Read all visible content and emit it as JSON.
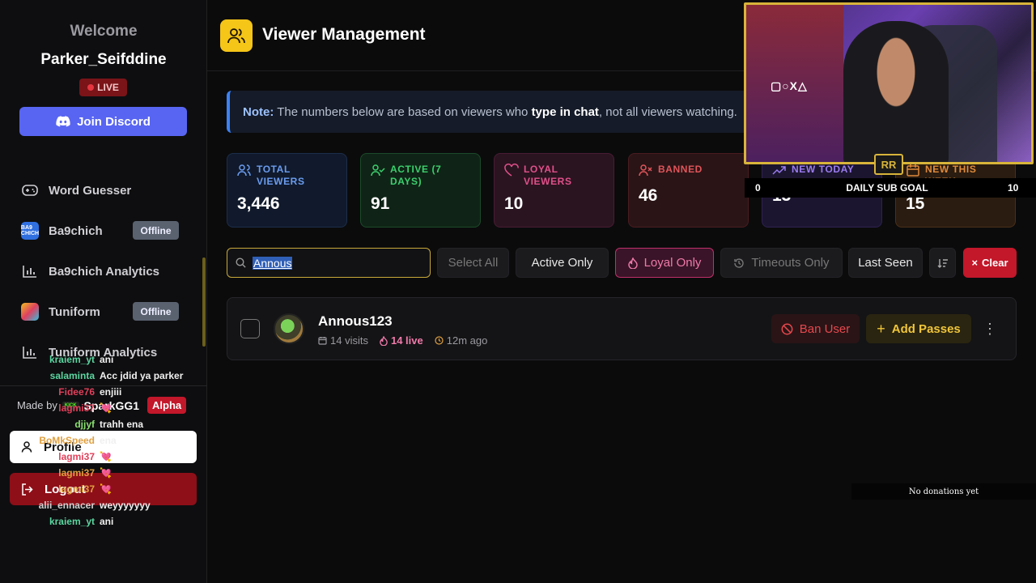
{
  "sidebar": {
    "welcome": "Welcome",
    "username": "Parker_Seifddine",
    "live": "LIVE",
    "discord": "Join Discord",
    "nav": [
      {
        "label": "Word Guesser"
      },
      {
        "label": "Ba9chich",
        "icon_text": "BA9 CHICH",
        "status": "Offline"
      },
      {
        "label": "Ba9chich Analytics"
      },
      {
        "label": "Tuniform",
        "status": "Offline"
      },
      {
        "label": "Tuniform Analytics"
      }
    ],
    "made_by": "Made by",
    "kick_tag": "KICK",
    "author": "SparkGG1",
    "alpha": "Alpha",
    "profile": "Profile",
    "logout": "Logout"
  },
  "chat": [
    {
      "user": "kraiem_yt",
      "msg": "ani",
      "color": "#5bd6a0"
    },
    {
      "user": "salaminta",
      "msg": "Acc jdid ya parker",
      "color": "#5bd6a0"
    },
    {
      "user": "Fidee76",
      "msg": "enjiii",
      "color": "#e0405a"
    },
    {
      "user": "lagmi37",
      "msg": "💘",
      "color": "#e0405a"
    },
    {
      "user": "djjyf",
      "msg": "trahh ena",
      "color": "#8ae070"
    },
    {
      "user": "BoMkSpeed",
      "msg": "ena",
      "color": "#e0a040"
    },
    {
      "user": "lagmi37",
      "msg": "💘",
      "color": "#e0405a"
    },
    {
      "user": "lagmi37",
      "msg": "💘",
      "color": "#e0a040"
    },
    {
      "user": "lagmi37",
      "msg": "💘",
      "color": "#e0a040"
    },
    {
      "user": "alii_ennacer",
      "msg": "weyyyyyyy",
      "color": "#d0d0d0"
    },
    {
      "user": "kraiem_yt",
      "msg": "ani",
      "color": "#5bd6a0"
    }
  ],
  "header": {
    "title": "Viewer Management"
  },
  "note": {
    "label": "Note:",
    "text1": " The numbers below are based on viewers who ",
    "emph": "type in chat",
    "text2": ", not all viewers watching."
  },
  "stats": [
    {
      "label": "TOTAL VIEWERS",
      "value": "3,446",
      "color": "#6b9cf0",
      "bg": "#101a2c",
      "border": "#1d2d4a",
      "icon": "users-icon"
    },
    {
      "label": "ACTIVE (7 DAYS)",
      "value": "91",
      "color": "#3ccf6e",
      "bg": "#0f2416",
      "border": "#1c4a2a",
      "icon": "user-check-icon"
    },
    {
      "label": "LOYAL VIEWERS",
      "value": "10",
      "color": "#e0508a",
      "bg": "#2a1420",
      "border": "#4a1c34",
      "icon": "heart-icon"
    },
    {
      "label": "BANNED",
      "value": "46",
      "color": "#e0555a",
      "bg": "#2a1416",
      "border": "#4a1c20",
      "icon": "user-x-icon"
    },
    {
      "label": "NEW TODAY",
      "value": "13",
      "color": "#9a7cf0",
      "bg": "#1c1530",
      "border": "#2e2250",
      "icon": "trending-up-icon"
    },
    {
      "label": "NEW THIS WEEK",
      "value": "15",
      "color": "#e08a3a",
      "bg": "#2a1c10",
      "border": "#4a3018",
      "icon": "calendar-icon"
    }
  ],
  "filters": {
    "search_value": "Annous",
    "select_all": "Select All",
    "active_only": "Active Only",
    "loyal_only": "Loyal Only",
    "timeouts_only": "Timeouts Only",
    "sort": "Last Seen",
    "clear": "Clear"
  },
  "users": [
    {
      "name": "Annous123",
      "visits": "14 visits",
      "live": "14 live",
      "seen": "12m ago",
      "ban": "Ban User",
      "passes": "Add Passes"
    }
  ],
  "overlay": {
    "goal_logo": "RR",
    "goal_min": "0",
    "goal_label": "DAILY SUB GOAL",
    "goal_max": "10",
    "donations": "No donations yet",
    "cam_sign": "▢○X△"
  },
  "colors": {
    "accent": "#f5c518",
    "discord": "#5865f2",
    "danger": "#c3172a"
  }
}
